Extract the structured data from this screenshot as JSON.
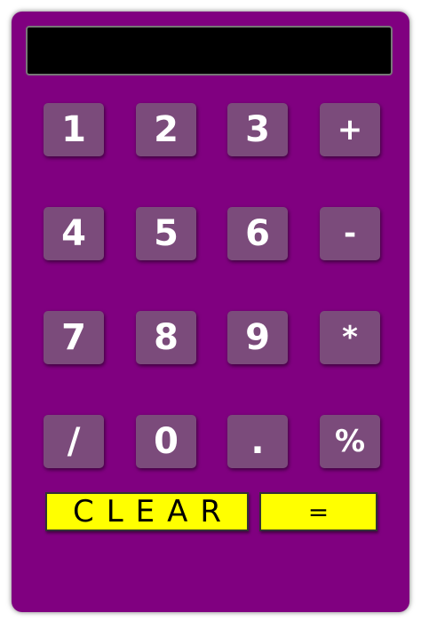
{
  "display": {
    "value": ""
  },
  "keys": {
    "one": "1",
    "two": "2",
    "three": "3",
    "plus": "+",
    "four": "4",
    "five": "5",
    "six": "6",
    "minus": "-",
    "seven": "7",
    "eight": "8",
    "nine": "9",
    "multiply": "*",
    "divide": "/",
    "zero": "0",
    "decimal": ".",
    "percent": "%"
  },
  "actions": {
    "clear_label": "CLEAR",
    "equals_label": "="
  },
  "colors": {
    "body": "#800080",
    "key": "#7b4b7b",
    "display": "#000000",
    "action_button": "#ffff00"
  }
}
